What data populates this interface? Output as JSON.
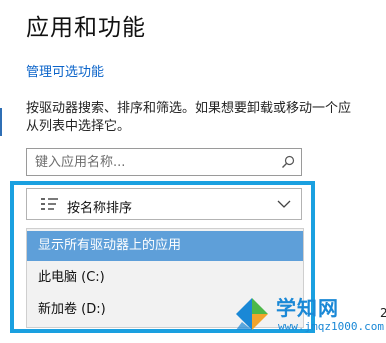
{
  "page": {
    "title": "应用和功能",
    "manage_link": "管理可选功能",
    "description_line1": "按驱动器搜索、排序和筛选。如果想要卸载或移动一个应",
    "description_line2": "从列表中选择它。"
  },
  "search": {
    "placeholder": "键入应用名称...",
    "value": ""
  },
  "sort": {
    "label": "按名称排序"
  },
  "drive_filter": {
    "options": [
      {
        "label": "显示所有驱动器上的应用",
        "selected": true
      },
      {
        "label": "此电脑 (C:)",
        "selected": false
      },
      {
        "label": "新加卷 (D:)",
        "selected": false
      }
    ]
  },
  "side_text": "2",
  "watermark": {
    "title": "学知网",
    "url": "www.jmqz1000.com"
  },
  "colors": {
    "accent": "#1aa0e0",
    "link": "#0a63c9",
    "selected_option": "#5e9fd9"
  },
  "icons": {
    "search": "search-icon",
    "sort": "sort-lines-icon",
    "dropdown": "chevron-down-icon"
  }
}
